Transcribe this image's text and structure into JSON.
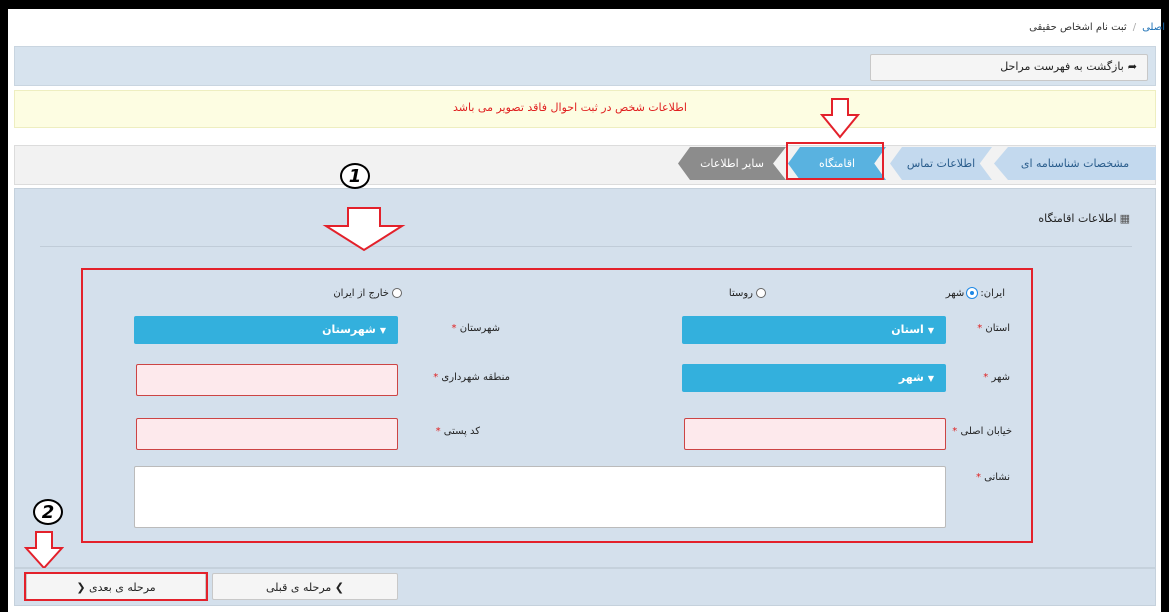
{
  "breadcrumb": {
    "home": "اصلی",
    "separator": "/",
    "current": "ثبت نام اشخاص حقیقی"
  },
  "toolbar": {
    "back_label": "بازگشت به فهرست مراحل",
    "back_icon": "arrow-return-icon"
  },
  "alert": {
    "text": "اطلاعات شخص در ثبت احوال فاقد تصویر می باشد"
  },
  "steps": [
    {
      "label": "مشخصات شناسنامه ای"
    },
    {
      "label": "اطلاعات تماس"
    },
    {
      "label": "اقامتگاه",
      "active": true
    },
    {
      "label": "سایر اطلاعات"
    }
  ],
  "section": {
    "title": "اطلاعات اقامتگاه",
    "icon": "grid-icon"
  },
  "form": {
    "iran_label": "ایران:",
    "radio_city": "شهر",
    "radio_village": "روستا",
    "radio_abroad": "خارج از ایران",
    "province_label": "استان",
    "province_value": "استان",
    "county_label": "شهرستان",
    "county_value": "شهرستان",
    "city_label": "شهر",
    "city_value": "شهر",
    "district_label": "منطقه شهرداری",
    "street_label": "خیابان اصلی",
    "postal_label": "کد پستی",
    "address_label": "نشانی",
    "required_mark": "*"
  },
  "footer": {
    "next_label": "مرحله ی بعدی",
    "prev_label": "مرحله ی قبلی"
  },
  "annotations": {
    "one": "1",
    "two": "2"
  },
  "colors": {
    "accent": "#33b0dd",
    "active_step": "#59b2e0",
    "highlight": "#e3212b",
    "alert_text": "#e02020"
  }
}
